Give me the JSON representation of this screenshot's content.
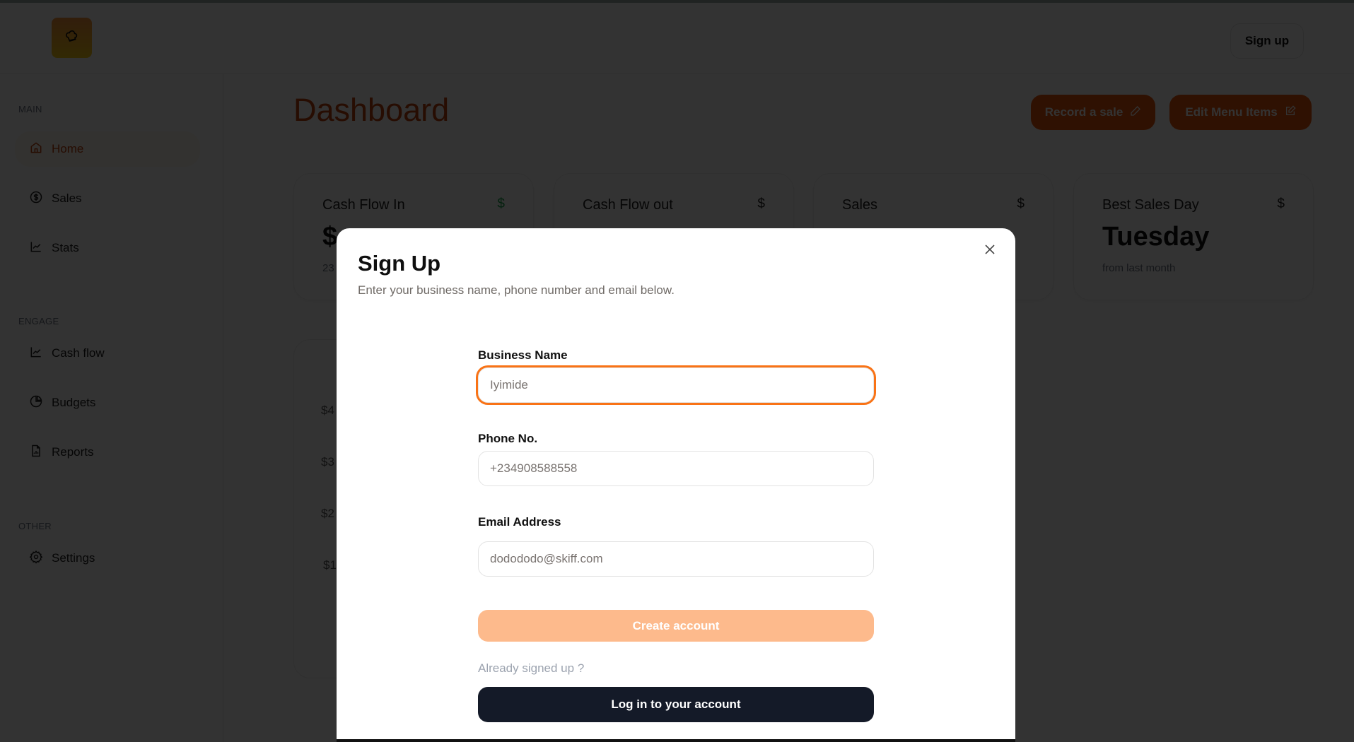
{
  "header": {
    "logo_icon": "chef-hat-icon",
    "signup_label": "Sign up"
  },
  "sidebar": {
    "sections": [
      {
        "label": "MAIN",
        "items": [
          {
            "label": "Home",
            "icon": "home-icon",
            "active": true
          },
          {
            "label": "Sales",
            "icon": "dollar-circle-icon"
          },
          {
            "label": "Stats",
            "icon": "line-chart-icon"
          }
        ]
      },
      {
        "label": "ENGAGE",
        "items": [
          {
            "label": "Cash flow",
            "icon": "line-chart-icon"
          },
          {
            "label": "Budgets",
            "icon": "pie-chart-icon"
          },
          {
            "label": "Reports",
            "icon": "file-chart-icon"
          }
        ]
      },
      {
        "label": "OTHER",
        "items": [
          {
            "label": "Settings",
            "icon": "gear-icon"
          }
        ]
      }
    ]
  },
  "main": {
    "title": "Dashboard",
    "actions": [
      {
        "label": "Record a sale",
        "icon": "pencil-icon"
      },
      {
        "label": "Edit Menu Items",
        "icon": "edit-square-icon"
      }
    ],
    "cards": [
      {
        "title": "Cash Flow In",
        "icon": "$",
        "value": "$",
        "sub": "23"
      },
      {
        "title": "Cash Flow out",
        "icon": "$",
        "value": "",
        "sub": ""
      },
      {
        "title": "Sales",
        "icon": "$",
        "value": "",
        "sub": ""
      },
      {
        "title": "Best Sales Day",
        "icon": "$",
        "value": "Tuesday",
        "sub": "from last month"
      }
    ],
    "chart_ticks": [
      "$4",
      "$3",
      "$2",
      "$1"
    ]
  },
  "modal": {
    "title": "Sign Up",
    "description": "Enter your business name, phone number and email below.",
    "fields": {
      "business_name": {
        "label": "Business Name",
        "placeholder": "Iyimide",
        "value": ""
      },
      "phone": {
        "label": "Phone No.",
        "placeholder": "+234908588558",
        "value": ""
      },
      "email": {
        "label": "Email Address",
        "placeholder": "dodododo@skiff.com",
        "value": ""
      }
    },
    "create_label": "Create account",
    "already_label": "Already signed up ?",
    "login_label": "Log in to your account",
    "close_icon": "close-icon"
  },
  "colors": {
    "accent": "#f97316",
    "accent_dark": "#ea580c",
    "create_button": "#fdba8c",
    "login_button": "#141a28",
    "logo_gradient_top": "#fb923c",
    "logo_gradient_bottom": "#facc15"
  }
}
